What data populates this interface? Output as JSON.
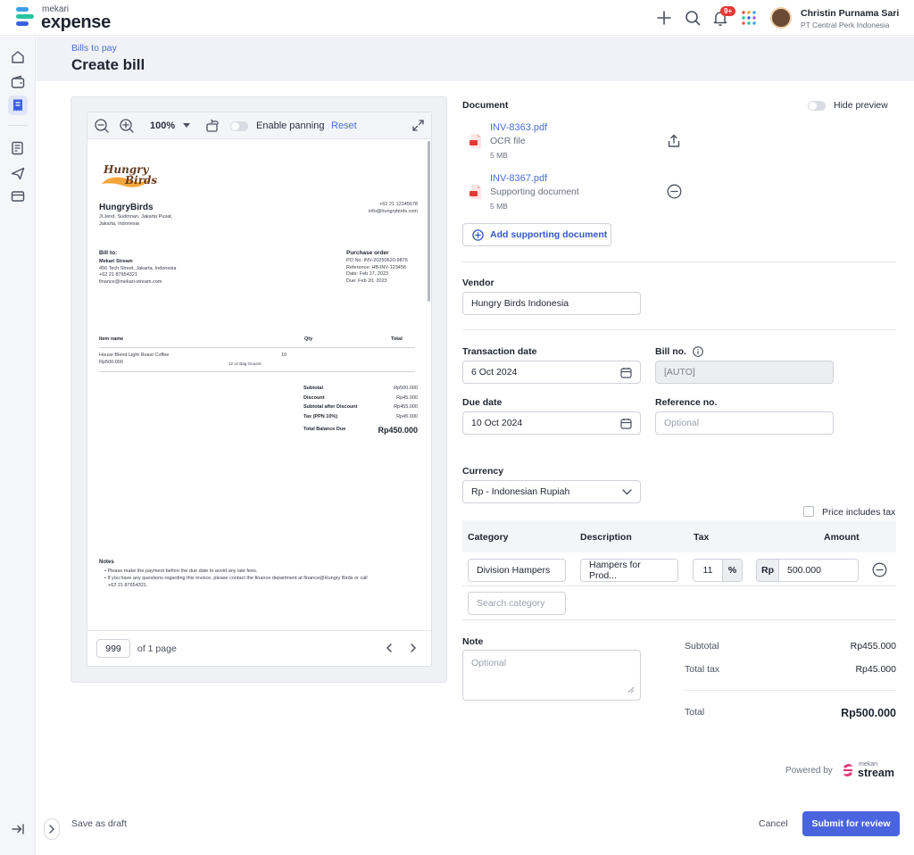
{
  "brand": {
    "small": "mekari",
    "name": "expense"
  },
  "topbar": {
    "notifications_badge": "9+",
    "user_name": "Christin Purnama Sari",
    "user_org": "PT Central Perk Indonesia"
  },
  "header": {
    "breadcrumb": "Bills to pay",
    "title": "Create bill"
  },
  "viewer": {
    "zoom": "100%",
    "panning_label": "Enable panning",
    "reset_label": "Reset",
    "page_value": "999",
    "page_total": "of 1 page"
  },
  "invoice": {
    "logo_line1": "Hungry",
    "logo_line2": "Birds",
    "company": "HungryBirds",
    "address1": "Jl.Jend. Sudirman, Jakarta Pusat,",
    "address2": "Jakarta, Indonesia",
    "phone": "+62 21 12345678",
    "email": "info@hungrybirds.com",
    "bill_to_label": "Bill to:",
    "bill_to_name": "Mekari Stream",
    "bill_to_address": "456 Tech Street, Jakarta, Indonesia",
    "bill_to_phone": "+62 21 87654321",
    "bill_to_email": "finance@mekari-stream.com",
    "po_label": "Purchase order",
    "po_no": "PO No. INV-20250620-9876",
    "po_ref": "Reference: HB-INV-123456",
    "po_date": "Date: Feb 17, 2023",
    "po_due": "Due: Feb 20, 2023",
    "col_item": "Item name",
    "col_qty": "Qty",
    "col_total": "Total",
    "item_name": "House Blend Light Roast Coffee",
    "item_price": "Rp500.000",
    "item_desc": "12 oz Bag Ground",
    "item_qty": "10",
    "subtotal_label": "Subtotal",
    "subtotal": "Rp500.000",
    "discount_label": "Discount",
    "discount": "Rp45.000",
    "after_discount_label": "Subtotal after Discount",
    "after_discount": "Rp455.000",
    "tax_label": "Tax (PPN 10%)",
    "tax": "Rp45.000",
    "balance_label": "Total Balance Due",
    "balance": "Rp450.000",
    "notes_label": "Notes",
    "note1": "• Please make the payment before the due date to avoid any late fees.",
    "note2": "• If you have any questions regarding this invoice, please contact the finance department at finance@Hungry Birds or call",
    "note3": "+62 21 87654321."
  },
  "document": {
    "label": "Document",
    "hide_preview": "Hide preview",
    "files": [
      {
        "name": "INV-8363.pdf",
        "type": "OCR file",
        "size": "5 MB"
      },
      {
        "name": "INV-8367.pdf",
        "type": "Supporting document",
        "size": "5 MB"
      }
    ],
    "add_button": "Add supporting document"
  },
  "form": {
    "vendor_label": "Vendor",
    "vendor_value": "Hungry Birds Indonesia",
    "transaction_date_label": "Transaction date",
    "transaction_date": "6 Oct 2024",
    "bill_no_label": "Bill no.",
    "bill_no": "[AUTO]",
    "due_date_label": "Due date",
    "due_date": "10 Oct 2024",
    "reference_label": "Reference no.",
    "reference_placeholder": "Optional",
    "currency_label": "Currency",
    "currency": "Rp - Indonesian Rupiah",
    "price_includes_tax": "Price includes tax"
  },
  "table": {
    "headers": [
      "Category",
      "Description",
      "Tax",
      "Amount"
    ],
    "row": {
      "category": "Division Hampers",
      "description": "Hampers for Prod...",
      "tax": "11",
      "tax_unit": "%",
      "currency": "Rp",
      "amount": "500.000"
    },
    "search_placeholder": "Search category"
  },
  "note": {
    "label": "Note",
    "placeholder": "Optional"
  },
  "summary": {
    "subtotal_label": "Subtotal",
    "subtotal": "Rp455.000",
    "tax_label": "Total tax",
    "tax": "Rp45.000",
    "total_label": "Total",
    "total": "Rp500.000"
  },
  "footer": {
    "powered_by": "Powered by",
    "stream_small": "mekari",
    "stream_name": "stream",
    "save_draft": "Save as draft",
    "cancel": "Cancel",
    "submit": "Submit for review"
  },
  "colors": {
    "accent": "#4a64e0",
    "link": "#4a6ee0",
    "danger": "#e53935"
  }
}
